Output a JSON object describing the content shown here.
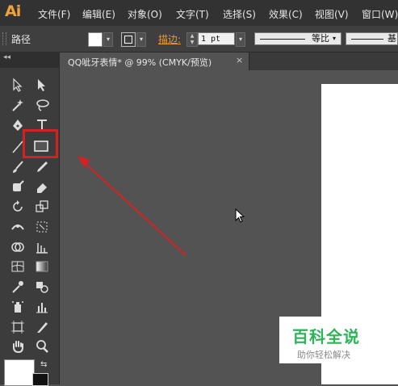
{
  "app": {
    "logo": "Ai"
  },
  "menu": [
    "文件(F)",
    "编辑(E)",
    "对象(O)",
    "文字(T)",
    "选择(S)",
    "效果(C)",
    "视图(V)",
    "窗口(W)"
  ],
  "control_bar": {
    "object_type": "路径",
    "stroke_label": "描边:",
    "stroke_weight": "1 pt",
    "profile_label": "等比",
    "brush_label": "基"
  },
  "document_tab": {
    "title": "QQ呲牙表情* @ 99% (CMYK/预览)",
    "close": "×"
  },
  "toolbox": {
    "collapse": "◂◂",
    "swap": "⇆"
  },
  "watermark": {
    "title": "百科全说",
    "subtitle": "助你轻松解决"
  },
  "colors": {
    "accent_orange": "#f1a33a",
    "highlight_red": "#d42121",
    "watermark_green": "#2db35a",
    "canvas": "#535353"
  }
}
